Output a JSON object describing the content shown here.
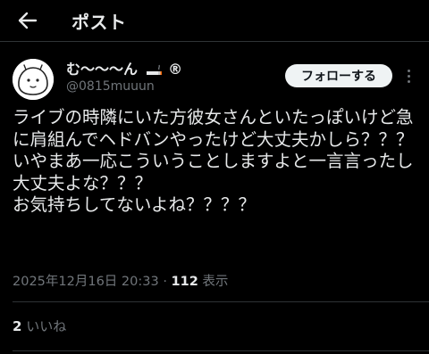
{
  "header": {
    "back_icon": "arrow-left-icon",
    "title": "ポスト"
  },
  "author": {
    "display_name": "む〜〜〜ん",
    "name_suffix": "®",
    "name_emoji_icon": "cigarette-icon",
    "handle": "@0815muuun",
    "avatar_icon": "cartoon-face-avatar"
  },
  "actions": {
    "follow_label": "フォローする",
    "more_icon": "more-vertical-icon"
  },
  "post": {
    "text": "ライブの時隣にいた方彼女さんといたっぽいけど急に肩組んでヘドバンやったけど大丈夫かしら？？？\nいやまあ一応こういうことしますよと一言言ったし大丈夫よな？？？\nお気持ちしてないよね？？？？"
  },
  "meta": {
    "timestamp": "2025年12月16日 20:33",
    "separator": "·",
    "views_count": "112",
    "views_label": "表示"
  },
  "stats": {
    "likes_count": "2",
    "likes_label": "いいね"
  },
  "colors": {
    "background": "#000000",
    "text_primary": "#e7e9ea",
    "text_secondary": "#71767b",
    "divider": "#2f3336",
    "follow_bg": "#eff3f4"
  }
}
